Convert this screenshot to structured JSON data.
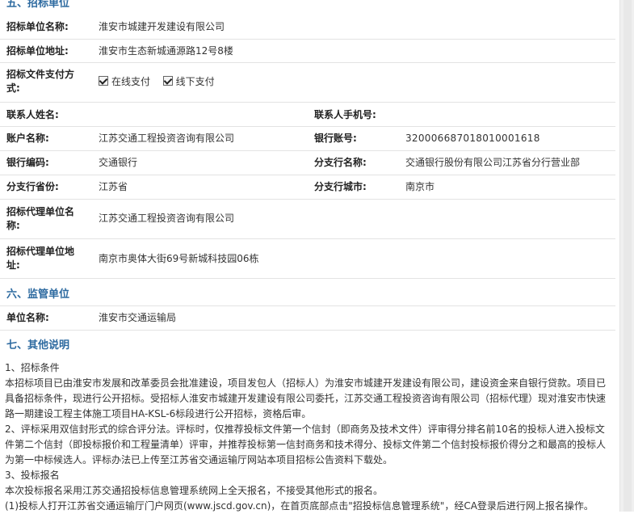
{
  "sections": {
    "s5_title": "五、招标单位",
    "s6_title": "六、监管单位",
    "s7_title": "七、其他说明"
  },
  "tenderer": {
    "name_label": "招标单位名称:",
    "name_value": "淮安市城建开发建设有限公司",
    "addr_label": "招标单位地址:",
    "addr_value": "淮安市生态新城通源路12号8楼",
    "pay_label": "招标文件支付方式:",
    "pay_online": "在线支付",
    "pay_offline": "线下支付",
    "contact_label": "联系人姓名:",
    "contact_value": "",
    "mobile_label": "联系人手机号:",
    "mobile_value": "",
    "account_name_label": "账户名称:",
    "account_name_value": "江苏交通工程投资咨询有限公司",
    "account_no_label": "银行账号:",
    "account_no_value": "320006687018010001618",
    "bank_code_label": "银行编码:",
    "bank_code_value": "交通银行",
    "branch_name_label": "分支行名称:",
    "branch_name_value": "交通银行股份有限公司江苏省分行营业部",
    "branch_province_label": "分支行省份:",
    "branch_province_value": "江苏省",
    "branch_city_label": "分支行城市:",
    "branch_city_value": "南京市",
    "agent_name_label": "招标代理单位名称:",
    "agent_name_value": "江苏交通工程投资咨询有限公司",
    "agent_addr_label": "招标代理单位地址:",
    "agent_addr_value": "南京市奥体大街69号新城科技园06栋"
  },
  "supervisor": {
    "name_label": "单位名称:",
    "name_value": "淮安市交通运输局"
  },
  "notes": {
    "p1_heading": "1、招标条件",
    "p1_body": "本招标项目已由淮安市发展和改革委员会批准建设，项目发包人（招标人）为淮安市城建开发建设有限公司，建设资金来自银行贷款。项目已具备招标条件，现进行公开招标。受招标人淮安市城建开发建设有限公司委托，江苏交通工程投资咨询有限公司（招标代理）现对淮安市快速路一期建设工程主体施工项目HA-KSL-6标段进行公开招标，资格后审。",
    "p2": "2、评标采用双信封形式的综合评分法。评标时，仅推荐投标文件第一个信封（即商务及技术文件）评审得分排名前10名的投标人进入投标文件第二个信封（即投标报价和工程量清单）评审，并推荐投标第一信封商务和技术得分、投标文件第二个信封投标报价得分之和最高的投标人为第一中标候选人。评标办法已上传至江苏省交通运输厅网站本项目招标公告资料下载处。",
    "p3_heading": "3、投标报名",
    "p3_body": "本次投标报名采用江苏交通招投标信息管理系统网上全天报名，不接受其他形式的报名。",
    "p3_item1": "(1)投标人打开江苏省交通运输厅门户网页(www.jscd.gov.cn)，在首页底部点击\"招投标信息管理系统\"，经CA登录后进行网上报名操作。"
  }
}
